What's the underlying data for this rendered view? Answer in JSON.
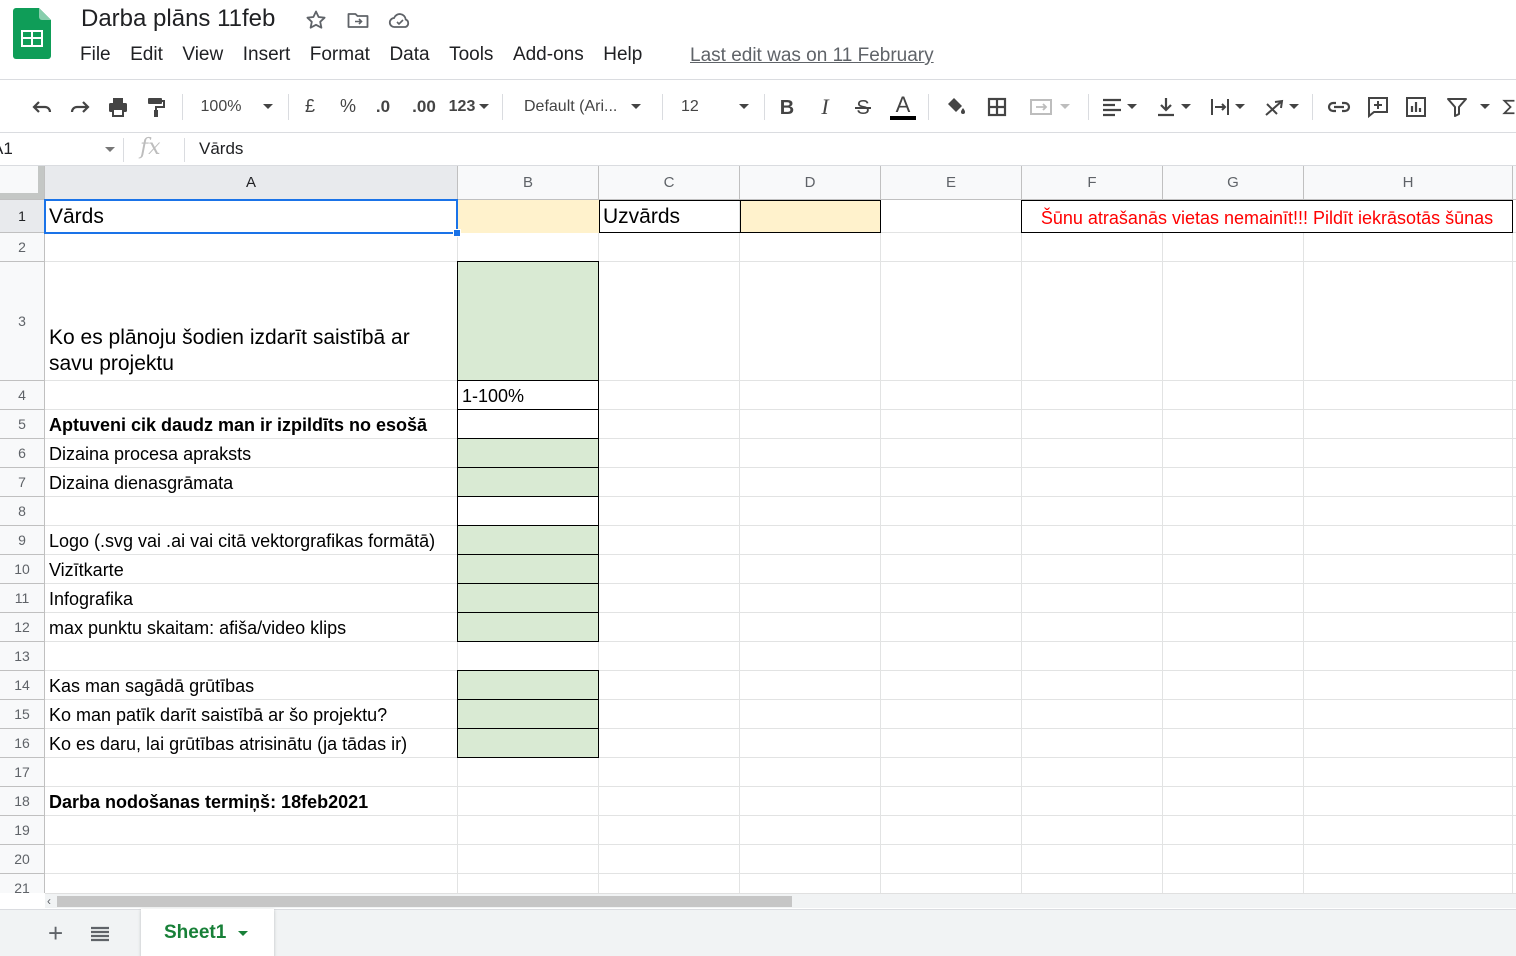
{
  "app": {
    "title": "Darba plāns 11feb",
    "menu": [
      "File",
      "Edit",
      "View",
      "Insert",
      "Format",
      "Data",
      "Tools",
      "Add-ons",
      "Help"
    ],
    "last_edit": "Last edit was on 11 February",
    "accent_color": "#0F9D58"
  },
  "toolbar": {
    "zoom": "100%",
    "currency": "£",
    "percent": "%",
    "decimal_decrease": ".0",
    "decimal_increase": ".00",
    "number_format": "123",
    "font": "Default (Ari...",
    "font_size": "12",
    "icons": [
      "undo-icon",
      "redo-icon",
      "print-icon",
      "paint-format-icon",
      "bold-icon",
      "italic-icon",
      "strikethrough-icon",
      "text-color-icon",
      "fill-color-icon",
      "borders-icon",
      "merge-cells-icon",
      "align-left-icon",
      "vertical-align-icon",
      "text-wrap-icon",
      "text-rotation-icon",
      "link-icon",
      "comment-icon",
      "chart-icon",
      "filter-icon",
      "functions-icon"
    ]
  },
  "formula_bar": {
    "name_box": "A1",
    "fx": "fx",
    "value": "Vārds"
  },
  "sheet": {
    "columns": [
      "A",
      "B",
      "C",
      "D",
      "E",
      "F",
      "G",
      "H"
    ],
    "rows": [
      "1",
      "2",
      "3",
      "4",
      "5",
      "6",
      "7",
      "8",
      "9",
      "10",
      "11",
      "12",
      "13",
      "14",
      "15",
      "16",
      "17",
      "18",
      "19",
      "20",
      "21"
    ],
    "colors": {
      "input_yellow": "#fff2cc",
      "input_green": "#d9ead3",
      "warning_red": "#ff0000"
    },
    "cells": {
      "A1": "Vārds",
      "C1": "Uzvārds",
      "F1": "Šūnu atrašanās vietas nemainīt!!! Pildīt iekrāsotās šūnas",
      "A3": "Ko es plānoju šodien izdarīt saistībā ar savu projektu",
      "B4": "1-100%",
      "A5": "Aptuveni cik daudz man ir izpildīts no esošā",
      "A6": "Dizaina procesa apraksts",
      "A7": "Dizaina dienasgrāmata",
      "A9": "Logo (.svg vai .ai vai citā vektorgrafikas formātā)",
      "A10": "Vizītkarte",
      "A11": "Infografika",
      "A12": "max punktu skaitam: afiša/video klips",
      "A14": "Kas man sagādā grūtības",
      "A15": "Ko man patīk darīt saistībā ar šo projektu?",
      "A16": "Ko es daru, lai grūtības atrisinātu (ja tādas ir)",
      "A18": "Darba nodošanas termiņš: 18feb2021"
    }
  },
  "bottom": {
    "add_sheet": "+",
    "sheet_tab": "Sheet1"
  }
}
